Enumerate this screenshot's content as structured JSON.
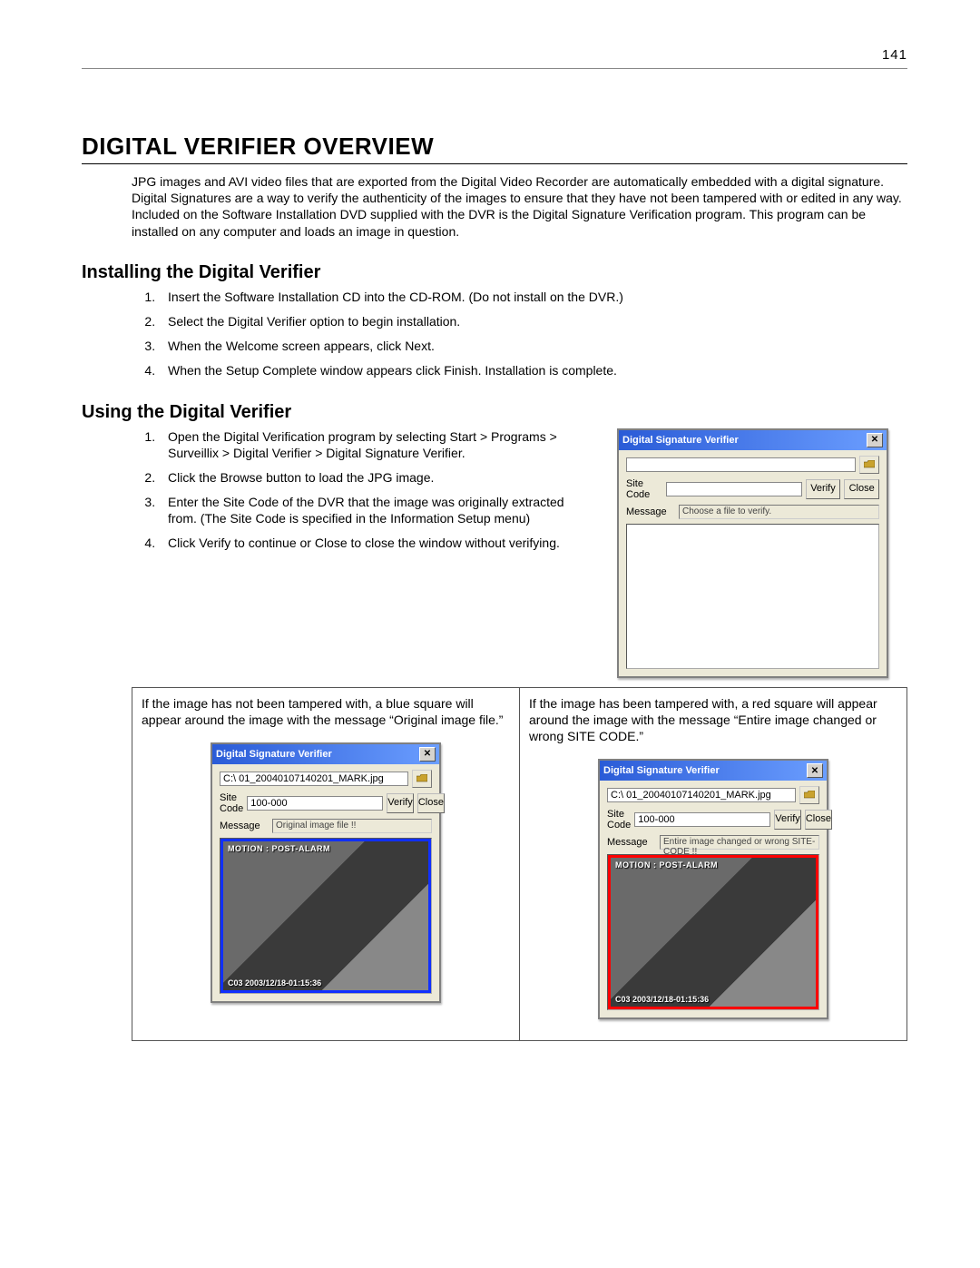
{
  "page_number": "141",
  "headings": {
    "main": "DIGITAL VERIFIER OVERVIEW",
    "install": "Installing the Digital Verifier",
    "using": "Using the Digital Verifier"
  },
  "intro": "JPG images and AVI video files that are exported from the Digital Video Recorder are automatically embedded with a digital signature. Digital Signatures are a way to verify the authenticity of the images to ensure that they have not been tampered with or edited in any way. Included on the Software Installation DVD supplied with the DVR is the Digital Signature Verification program. This program can be installed on any computer and loads an image in question.",
  "install_steps": [
    "Insert the Software Installation CD into the CD-ROM. (Do not install on the DVR.)",
    "Select the Digital Verifier option to begin installation.",
    "When the Welcome screen appears, click Next.",
    "When the Setup Complete window appears click Finish. Installation is complete."
  ],
  "using_steps": [
    "Open the Digital Verification program by selecting Start > Programs > Surveillix > Digital Verifier > Digital Signature Verifier.",
    "Click the Browse button to load the JPG image.",
    "Enter the Site Code of the DVR that the image was originally extracted from. (The Site Code is specified in the Information Setup menu)",
    "Click Verify to continue or Close to close the window without verifying."
  ],
  "dialog": {
    "title": "Digital Signature Verifier",
    "close_glyph": "✕",
    "labels": {
      "sitecode": "Site Code",
      "message": "Message"
    },
    "buttons": {
      "verify": "Verify",
      "close": "Close"
    },
    "empty": {
      "path": "",
      "sitecode": "",
      "msg": "Choose a file to verify."
    },
    "ok": {
      "path": "C:\\ 01_20040107140201_MARK.jpg",
      "sitecode": "100-000",
      "msg": "Original image file !!"
    },
    "bad": {
      "path": "C:\\ 01_20040107140201_MARK.jpg",
      "sitecode": "100-000",
      "msg": "Entire image changed or wrong SITE-CODE !!"
    },
    "overlay": {
      "top": "MOTION : POST-ALARM",
      "bottom": "C03 2003/12/18-01:15:36"
    }
  },
  "compare": {
    "ok_caption": "If the image has not been tampered with, a blue square will appear around the image with the message “Original image file.”",
    "bad_caption": "If the image has been tampered with, a red square will appear around the image with the message “Entire image changed or wrong SITE CODE.”"
  }
}
